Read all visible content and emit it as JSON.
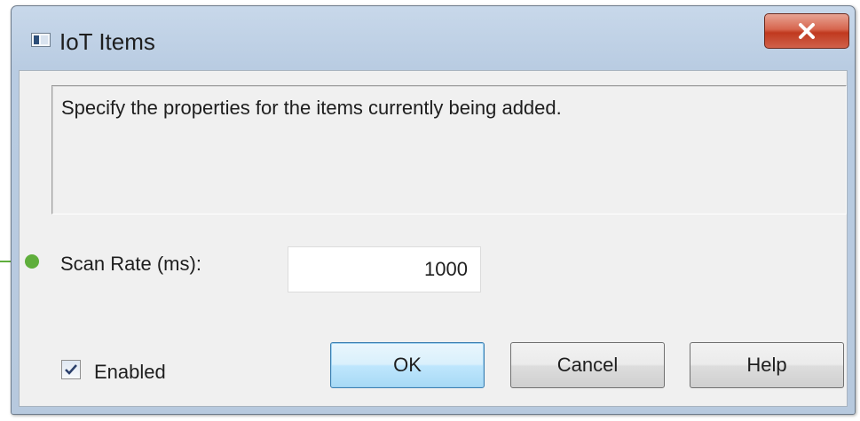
{
  "window": {
    "title": "IoT Items",
    "icon": "app-window-icon",
    "close_icon": "close-icon"
  },
  "description": "Specify the properties for the items currently being added.",
  "scan_rate": {
    "label": "Scan Rate (ms):",
    "value": "1000"
  },
  "enabled": {
    "label": "Enabled",
    "checked": true
  },
  "buttons": {
    "ok": "OK",
    "cancel": "Cancel",
    "help": "Help"
  },
  "colors": {
    "callout": "#5fae3c",
    "close_button": "#c0391f",
    "default_button_border": "#3c7fb1"
  }
}
